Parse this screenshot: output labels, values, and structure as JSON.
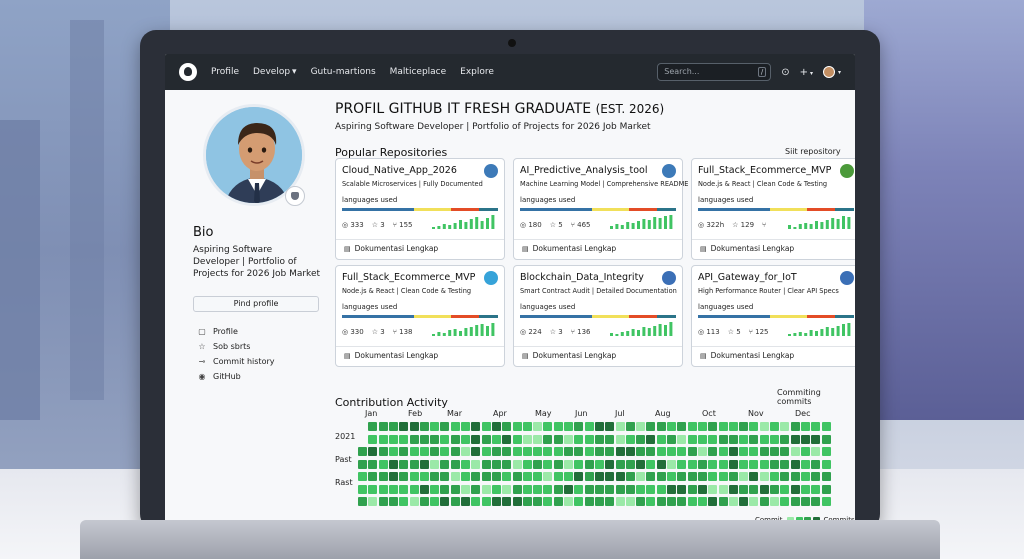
{
  "nav": {
    "items": [
      {
        "label": "Profile",
        "caret": false
      },
      {
        "label": "Develop",
        "caret": true
      },
      {
        "label": "Gutu-martions",
        "caret": false
      },
      {
        "label": "Malticeplace",
        "caret": false
      },
      {
        "label": "Explore",
        "caret": false
      }
    ],
    "search_placeholder": "Search...",
    "search_key": "/",
    "plus_label": "+"
  },
  "profile": {
    "title": "PROFIL GITHUB IT FRESH GRADUATE",
    "title_suffix": "(EST. 2026)",
    "subtitle": "Aspiring Software Developer | Portfolio of Projects for 2026 Job Market",
    "bio_heading": "Bio",
    "bio_text": "Aspiring Software Developer | Portfolio of Projects for 2026 Job Market",
    "pind_button": "Pind profile",
    "links": [
      {
        "icon": "file-icon",
        "glyph": "▢",
        "label": "Profile"
      },
      {
        "icon": "star-icon",
        "glyph": "☆",
        "label": "Sob sbrts"
      },
      {
        "icon": "commit-icon",
        "glyph": "⊸",
        "label": "Commit history"
      },
      {
        "icon": "github-icon",
        "glyph": "◉",
        "label": "GitHub"
      }
    ]
  },
  "repos": {
    "heading": "Popular Repositories",
    "link": "Siit repository",
    "cards": [
      {
        "name": "Cloud_Native_App_2026",
        "desc": "Scalable Microservices | Fully Documented",
        "lang_label": "languages used",
        "stars": "333",
        "forks": "3",
        "other": "155",
        "doc": "Dokumentasi Lengkap",
        "icon": "python-icon",
        "icon_color": "#3d7ab8"
      },
      {
        "name": "AI_Predictive_Analysis_tool",
        "desc": "Machine Learning Model | Comprehensive README",
        "lang_label": "languages used",
        "stars": "180",
        "forks": "5",
        "other": "465",
        "doc": "Dokumentasi Lengkap",
        "icon": "python-icon",
        "icon_color": "#3d7ab8"
      },
      {
        "name": "Full_Stack_Ecommerce_MVP",
        "desc": "Node.js & React | Clean Code & Testing",
        "lang_label": "languages used",
        "stars": "322h",
        "forks": "129",
        "other": "",
        "doc": "Dokumentasi Lengkap",
        "icon": "node-icon",
        "icon_color": "#4c9a3a"
      },
      {
        "name": "Full_Stack_Ecommerce_MVP",
        "desc": "Node.js & React | Clean Code & Testing",
        "lang_label": "languages used",
        "stars": "330",
        "forks": "3",
        "other": "138",
        "doc": "Dokumentasi Lengkap",
        "icon": "react-icon",
        "icon_color": "#36a3d9"
      },
      {
        "name": "Blockchain_Data_Integrity",
        "desc": "Smart Contract Audit | Detailed Documentation",
        "lang_label": "languages used",
        "stars": "224",
        "forks": "3",
        "other": "136",
        "doc": "Dokumentasi Lengkap",
        "icon": "gear-icon",
        "icon_color": "#3b6fb6"
      },
      {
        "name": "API_Gateway_for_IoT",
        "desc": "High Performance Router | Clear API Specs",
        "lang_label": "languages used",
        "stars": "113",
        "forks": "5",
        "other": "125",
        "doc": "Dokumentasi Lengkap",
        "icon": "gear-icon",
        "icon_color": "#3b6fb6"
      }
    ],
    "lang_colors": [
      "#3572A5",
      "#f1e05a",
      "#e34c26",
      "#2b7489"
    ]
  },
  "contributions": {
    "heading": "Contribution Activity",
    "note": "Commiting commits",
    "months": [
      "Jan",
      "Feb",
      "Mar",
      "Apr",
      "May",
      "Jun",
      "Jul",
      "Aug",
      "Oct",
      "Nov",
      "Dec"
    ],
    "row_labels": [
      "2021",
      "Past",
      "Rast"
    ],
    "legend_left": "Commit",
    "legend_right": "Commits",
    "levels": [
      "#9be9a8",
      "#40c463",
      "#30a14e",
      "#216e39"
    ]
  }
}
